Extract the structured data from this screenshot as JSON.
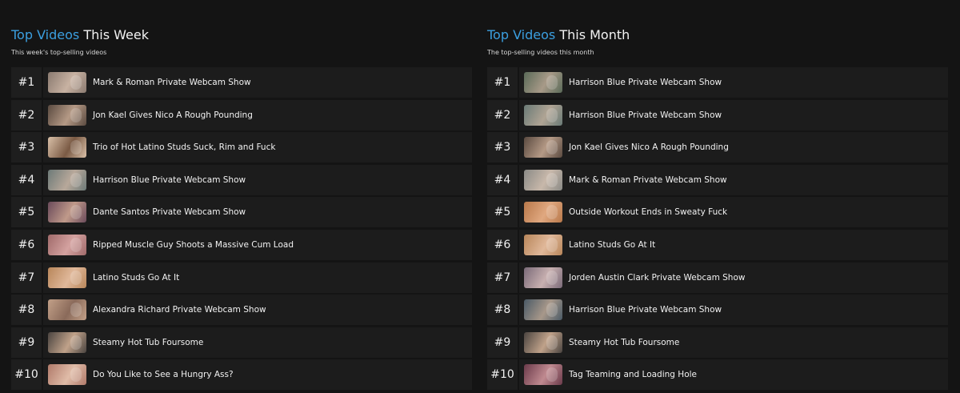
{
  "week": {
    "title_accent": "Top Videos",
    "title_rest": " This Week",
    "subtitle": "This week's top-selling videos",
    "items": [
      {
        "rank": "#1",
        "title": "Mark & Roman Private Webcam Show",
        "thumb_colors": [
          "#8a7a70",
          "#c8b2a2"
        ]
      },
      {
        "rank": "#2",
        "title": "Jon Kael Gives Nico A Rough Pounding",
        "thumb_colors": [
          "#5a4a40",
          "#b59a86"
        ]
      },
      {
        "rank": "#3",
        "title": "Trio of Hot Latino Studs Suck, Rim and Fuck",
        "thumb_colors": [
          "#d9c0a8",
          "#7a5a44"
        ]
      },
      {
        "rank": "#4",
        "title": "Harrison Blue Private Webcam Show",
        "thumb_colors": [
          "#6d7a78",
          "#b8a89a"
        ]
      },
      {
        "rank": "#5",
        "title": "Dante Santos Private Webcam Show",
        "thumb_colors": [
          "#6a4a5a",
          "#c09a8a"
        ]
      },
      {
        "rank": "#6",
        "title": "Ripped Muscle Guy Shoots a Massive Cum Load",
        "thumb_colors": [
          "#a06a6a",
          "#d4a2a0"
        ]
      },
      {
        "rank": "#7",
        "title": "Latino Studs Go At It",
        "thumb_colors": [
          "#b8865a",
          "#e0b89a"
        ]
      },
      {
        "rank": "#8",
        "title": "Alexandra Richard Private Webcam Show",
        "thumb_colors": [
          "#c2a088",
          "#8a6a5a"
        ]
      },
      {
        "rank": "#9",
        "title": "Steamy Hot Tub Foursome",
        "thumb_colors": [
          "#4a4440",
          "#c0a28a"
        ]
      },
      {
        "rank": "#10",
        "title": "Do You Like to See a Hungry Ass?",
        "thumb_colors": [
          "#b07a6a",
          "#e0bca8"
        ]
      }
    ]
  },
  "month": {
    "title_accent": "Top Videos",
    "title_rest": " This Month",
    "subtitle": "The top-selling videos this month",
    "items": [
      {
        "rank": "#1",
        "title": "Harrison Blue Private Webcam Show",
        "thumb_colors": [
          "#5a6a58",
          "#a89a88"
        ]
      },
      {
        "rank": "#2",
        "title": "Harrison Blue Private Webcam Show",
        "thumb_colors": [
          "#6a7a76",
          "#b0a494"
        ]
      },
      {
        "rank": "#3",
        "title": "Jon Kael Gives Nico A Rough Pounding",
        "thumb_colors": [
          "#5a4a40",
          "#b59a86"
        ]
      },
      {
        "rank": "#4",
        "title": "Mark & Roman Private Webcam Show",
        "thumb_colors": [
          "#8a8a86",
          "#c8b8aa"
        ]
      },
      {
        "rank": "#5",
        "title": "Outside Workout Ends in Sweaty Fuck",
        "thumb_colors": [
          "#b8784a",
          "#e0a880"
        ]
      },
      {
        "rank": "#6",
        "title": "Latino Studs Go At It",
        "thumb_colors": [
          "#b8865a",
          "#e0b89a"
        ]
      },
      {
        "rank": "#7",
        "title": "Jorden Austin Clark Private Webcam Show",
        "thumb_colors": [
          "#7a6a78",
          "#c8b0b0"
        ]
      },
      {
        "rank": "#8",
        "title": "Harrison Blue Private Webcam Show",
        "thumb_colors": [
          "#4a5a66",
          "#a8988a"
        ]
      },
      {
        "rank": "#9",
        "title": "Steamy Hot Tub Foursome",
        "thumb_colors": [
          "#4a4440",
          "#c0a28a"
        ]
      },
      {
        "rank": "#10",
        "title": "Tag Teaming and Loading Hole",
        "thumb_colors": [
          "#6a3a4a",
          "#c08a90"
        ]
      }
    ]
  }
}
